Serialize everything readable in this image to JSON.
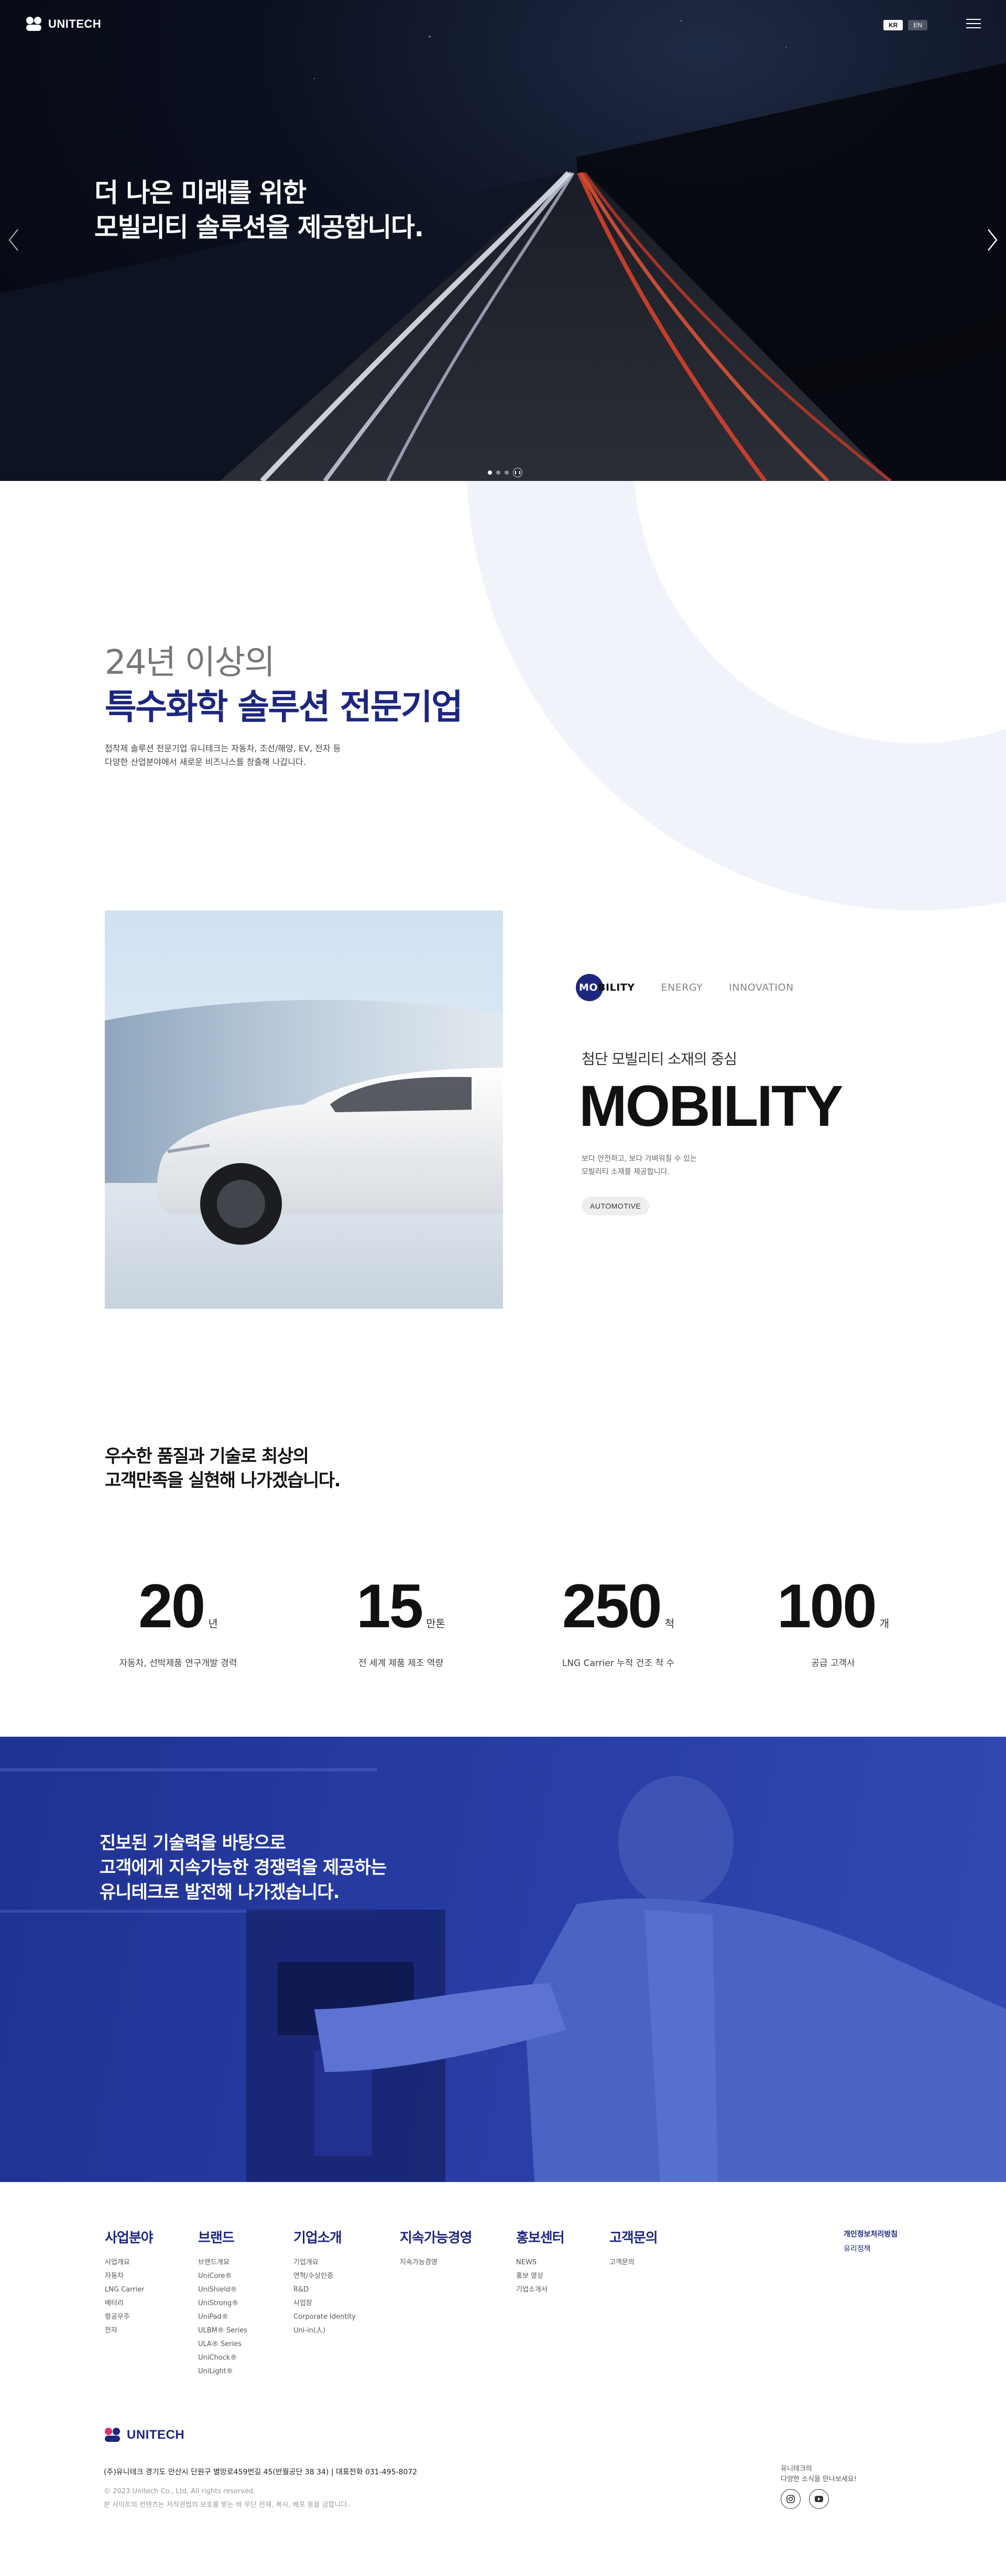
{
  "header": {
    "logo_text": "UNITECH",
    "lang": [
      "KR",
      "EN"
    ]
  },
  "hero": {
    "title_line1": "더 나은 미래를 위한",
    "title_line2": "모빌리티 솔루션을 제공합니다.",
    "slide_count": 3,
    "active_slide": 1
  },
  "intro": {
    "sub": "24년 이상의",
    "title": "특수화학 솔루션 전문기업",
    "desc_line1": "접착제 솔루션 전문기업 유니테크는 자동차, 조선/해양, EV, 전자 등",
    "desc_line2": "다양한 산업분야에서 새로운 비즈니스를 창출해 나갑니다."
  },
  "business": {
    "tabs": [
      {
        "hl": "MO",
        "rest": "BILITY"
      },
      {
        "label": "ENERGY"
      },
      {
        "label": "INNOVATION"
      }
    ],
    "kicker": "첨단 모빌리티 소재의 중심",
    "big": "MOBILITY",
    "desc_line1": "보다 안전하고, 보다 가벼워질 수 있는",
    "desc_line2": "모빌리티 소재를 제공합니다.",
    "tag": "AUTOMOTIVE"
  },
  "stats": {
    "headline_line1": "우수한 품질과 기술로 최상의",
    "headline_line2": "고객만족을 실현해 나가겠습니다.",
    "items": [
      {
        "num": "20",
        "unit": "년",
        "label": "자동차, 선박제품 연구개발 경력"
      },
      {
        "num": "15",
        "unit": "만톤",
        "label": "전 세계 제품 제조 역량"
      },
      {
        "num": "250",
        "unit": "척",
        "label": "LNG Carrier 누적 건조 척 수"
      },
      {
        "num": "100",
        "unit": "개",
        "label": "공급 고객사"
      }
    ]
  },
  "banner": {
    "line1": "진보된 기술력을 바탕으로",
    "line2": "고객에게 지속가능한 경쟁력을 제공하는",
    "line3": "유니테크로 발전해 나가겠습니다."
  },
  "footer": {
    "columns": [
      {
        "title": "사업분야",
        "items": [
          "사업개요",
          "자동차",
          "LNG Carrier",
          "배터리",
          "항공우주",
          "전자"
        ]
      },
      {
        "title": "브랜드",
        "items": [
          "브랜드개요",
          "UniCore®",
          "UniShield®",
          "UniStrong®",
          "UniPad®",
          "ULBM® Series",
          "ULA® Series",
          "UniChock®",
          "UniLight®"
        ]
      },
      {
        "title": "기업소개",
        "items": [
          "기업개요",
          "연혁/수상인증",
          "R&D",
          "사업장",
          "Corporate Identity",
          "Uni-in(人)"
        ]
      },
      {
        "title": "지속가능경영",
        "items": [
          "지속가능경영"
        ]
      },
      {
        "title": "홍보센터",
        "items": [
          "NEWS",
          "홍보 영상",
          "기업소개서"
        ]
      },
      {
        "title": "고객문의",
        "items": [
          "고객문의"
        ]
      }
    ],
    "policy": [
      "개인정보처리방침",
      "유리정책"
    ],
    "logo_text": "UNITECH",
    "address": "(주)유니테크 경기도 안산시 단원구 별망로459번길 45(반월공단 38 34) | 대표전화 031-495-8072",
    "copyright": "© 2023 Unitech Co., Ltd. All rights reserved.",
    "notice": "본 사이트의 컨텐츠는 저작권법의 보호를 받는 바 무단 전재, 복사, 배포 등을 금합니다.",
    "right_line1": "유니테크의",
    "right_line2": "다양한 소식을 만나보세요!"
  },
  "colors": {
    "brand_navy": "#1d2780",
    "banner_blue": "#2a3fa4",
    "logo_pink": "#e0306e"
  }
}
